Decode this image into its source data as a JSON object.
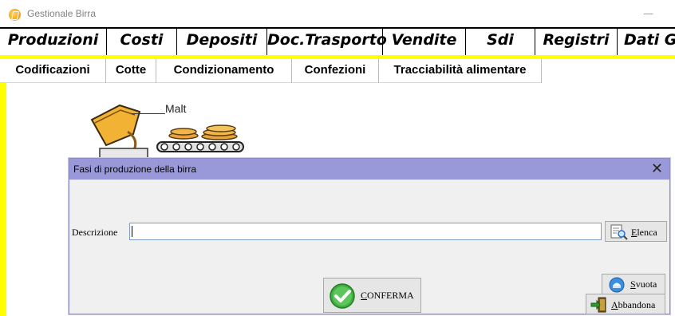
{
  "window": {
    "title": "Gestionale Birra",
    "minimize_glyph": "—"
  },
  "main_menu": [
    {
      "label": "Produzioni",
      "active": true
    },
    {
      "label": "Costi"
    },
    {
      "label": "Depositi"
    },
    {
      "label": "Doc.Trasporto"
    },
    {
      "label": "Vendite"
    },
    {
      "label": "Sdi"
    },
    {
      "label": "Registri"
    },
    {
      "label": "Dati G"
    }
  ],
  "sub_menu": [
    {
      "label": "Codificazioni"
    },
    {
      "label": "Cotte"
    },
    {
      "label": "Condizionamento"
    },
    {
      "label": "Confezioni"
    },
    {
      "label": "Tracciabilità alimentare"
    }
  ],
  "illustration": {
    "label": "Malt"
  },
  "dialog": {
    "title": "Fasi di produzione della birra",
    "close_glyph": "✕",
    "description_label": "Descrizione",
    "description_value": "",
    "buttons": {
      "elenca": "Elenca",
      "conferma": "CONFERMA",
      "svuota": "Svuota",
      "abbandona": "Abbandona"
    }
  },
  "colors": {
    "accent_yellow": "#ffff00",
    "dialog_titlebar": "#9999d9",
    "dialog_body": "#f0f0f0",
    "input_border": "#7a9cc7",
    "check_green": "#3fae3f"
  },
  "icons": [
    "app-icon",
    "search-list-icon",
    "check-icon",
    "clear-icon",
    "exit-icon",
    "close-icon"
  ]
}
